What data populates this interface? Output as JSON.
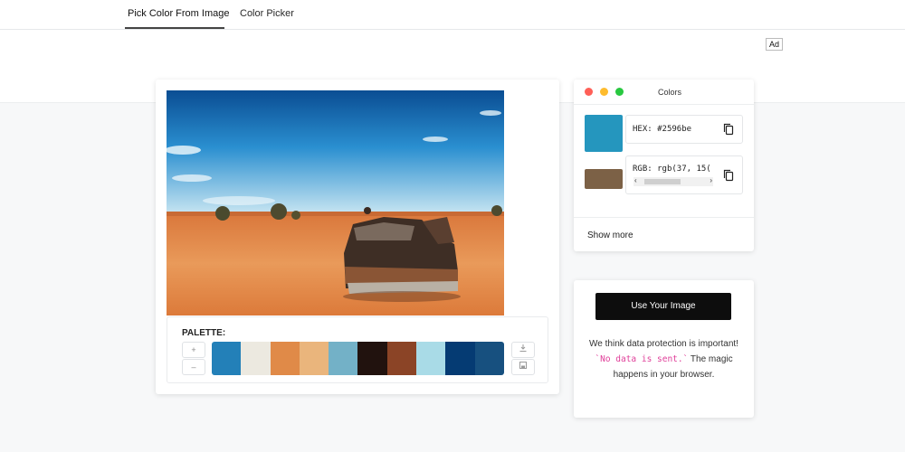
{
  "tabs": [
    {
      "label": "Pick Color From Image",
      "active": true
    },
    {
      "label": "Color Picker",
      "active": false
    }
  ],
  "ad_label": "Ad",
  "palette": {
    "title": "PALETTE:",
    "add_label": "+",
    "remove_label": "–",
    "swatches": [
      "#2380b8",
      "#ece9e0",
      "#e08a48",
      "#eab57c",
      "#73b1c7",
      "#21120e",
      "#8b4426",
      "#a9dbe7",
      "#053b73",
      "#17507f"
    ]
  },
  "colors_panel": {
    "title": "Colors",
    "traffic_lights": [
      "#ff5f57",
      "#febc2e",
      "#28c840"
    ],
    "hex": {
      "swatch": "#2596be",
      "label": "HEX:",
      "value": "#2596be"
    },
    "rgb": {
      "swatch": "#7c6146",
      "label": "RGB:",
      "value": "rgb(37, 15("
    },
    "show_more": "Show more"
  },
  "upload": {
    "button_label": "Use Your Image",
    "note_before": "We think data protection is important! ",
    "note_code": "`No data is sent.`",
    "note_after": " The magic happens in your browser."
  }
}
